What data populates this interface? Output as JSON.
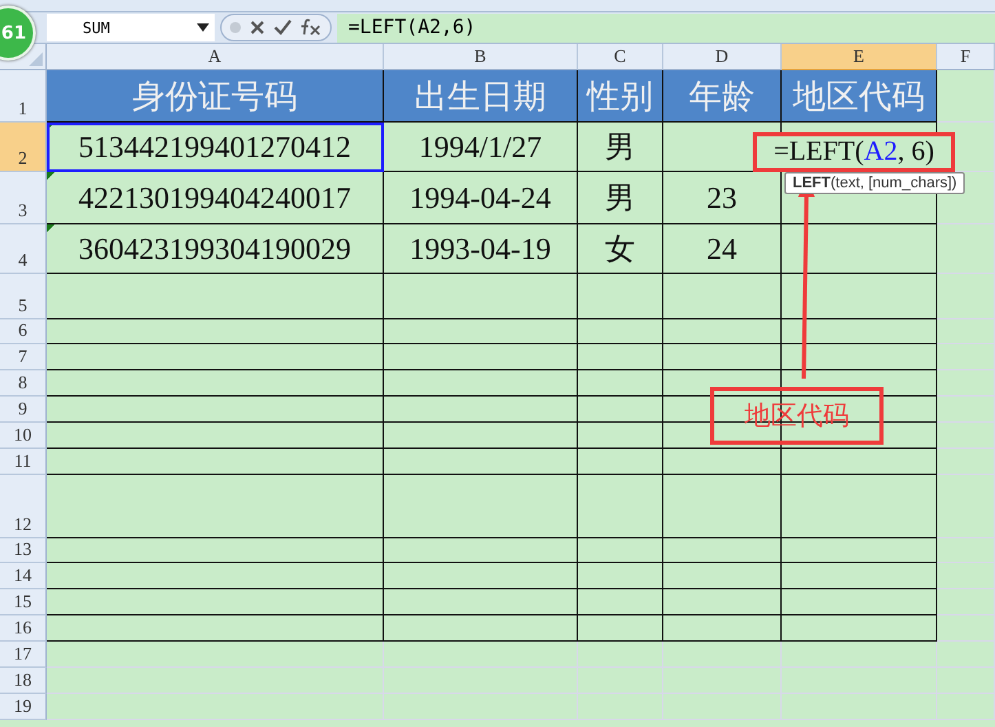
{
  "badge": "61",
  "name_box": {
    "value": "SUM"
  },
  "formula_bar": {
    "value": "=LEFT(A2,6)"
  },
  "columns": [
    {
      "label": "A",
      "selected": false
    },
    {
      "label": "B",
      "selected": false
    },
    {
      "label": "C",
      "selected": false
    },
    {
      "label": "D",
      "selected": false
    },
    {
      "label": "E",
      "selected": true
    },
    {
      "label": "F",
      "selected": false
    }
  ],
  "rows": [
    {
      "label": "1",
      "selected": false,
      "kind": "header",
      "cells": {
        "A": {
          "text": "身份证号码"
        },
        "B": {
          "text": "出生日期"
        },
        "C": {
          "text": "性别"
        },
        "D": {
          "text": "年龄"
        },
        "E": {
          "text": "地区代码"
        }
      }
    },
    {
      "label": "2",
      "selected": true,
      "kind": "data",
      "cells": {
        "A": {
          "text": "513442199401270412",
          "flag": true,
          "highlighted": true
        },
        "B": {
          "text": "1994/1/27"
        },
        "C": {
          "text": "男"
        }
      }
    },
    {
      "label": "3",
      "selected": false,
      "kind": "data",
      "cells": {
        "A": {
          "text": "422130199404240017",
          "flag": true
        },
        "B": {
          "text": "1994-04-24"
        },
        "C": {
          "text": "男"
        },
        "D": {
          "text": "23"
        }
      }
    },
    {
      "label": "4",
      "selected": false,
      "kind": "data",
      "cells": {
        "A": {
          "text": "360423199304190029",
          "flag": true
        },
        "B": {
          "text": "1993-04-19"
        },
        "C": {
          "text": "女"
        },
        "D": {
          "text": "24"
        }
      }
    },
    {
      "label": "5",
      "selected": false,
      "kind": "data"
    },
    {
      "label": "6",
      "selected": false,
      "kind": "data"
    },
    {
      "label": "7",
      "selected": false,
      "kind": "data"
    },
    {
      "label": "8",
      "selected": false,
      "kind": "data"
    },
    {
      "label": "9",
      "selected": false,
      "kind": "data"
    },
    {
      "label": "10",
      "selected": false,
      "kind": "data"
    },
    {
      "label": "11",
      "selected": false,
      "kind": "data"
    },
    {
      "label": "12",
      "selected": false,
      "kind": "data"
    },
    {
      "label": "13",
      "selected": false,
      "kind": "data"
    },
    {
      "label": "14",
      "selected": false,
      "kind": "data"
    },
    {
      "label": "15",
      "selected": false,
      "kind": "data"
    },
    {
      "label": "16",
      "selected": false,
      "kind": "data"
    },
    {
      "label": "17",
      "selected": false,
      "kind": "blank"
    },
    {
      "label": "18",
      "selected": false,
      "kind": "blank"
    },
    {
      "label": "19",
      "selected": false,
      "kind": "blank"
    }
  ],
  "cell_editor": {
    "parts": [
      {
        "text": "=LEFT(",
        "kind": "plain"
      },
      {
        "text": "A2",
        "kind": "reference"
      },
      {
        "text": ", 6)",
        "kind": "plain"
      }
    ]
  },
  "tooltip": {
    "text": "**LEFT**(text, [num_chars])"
  },
  "annotation": {
    "label": "地区代码"
  }
}
